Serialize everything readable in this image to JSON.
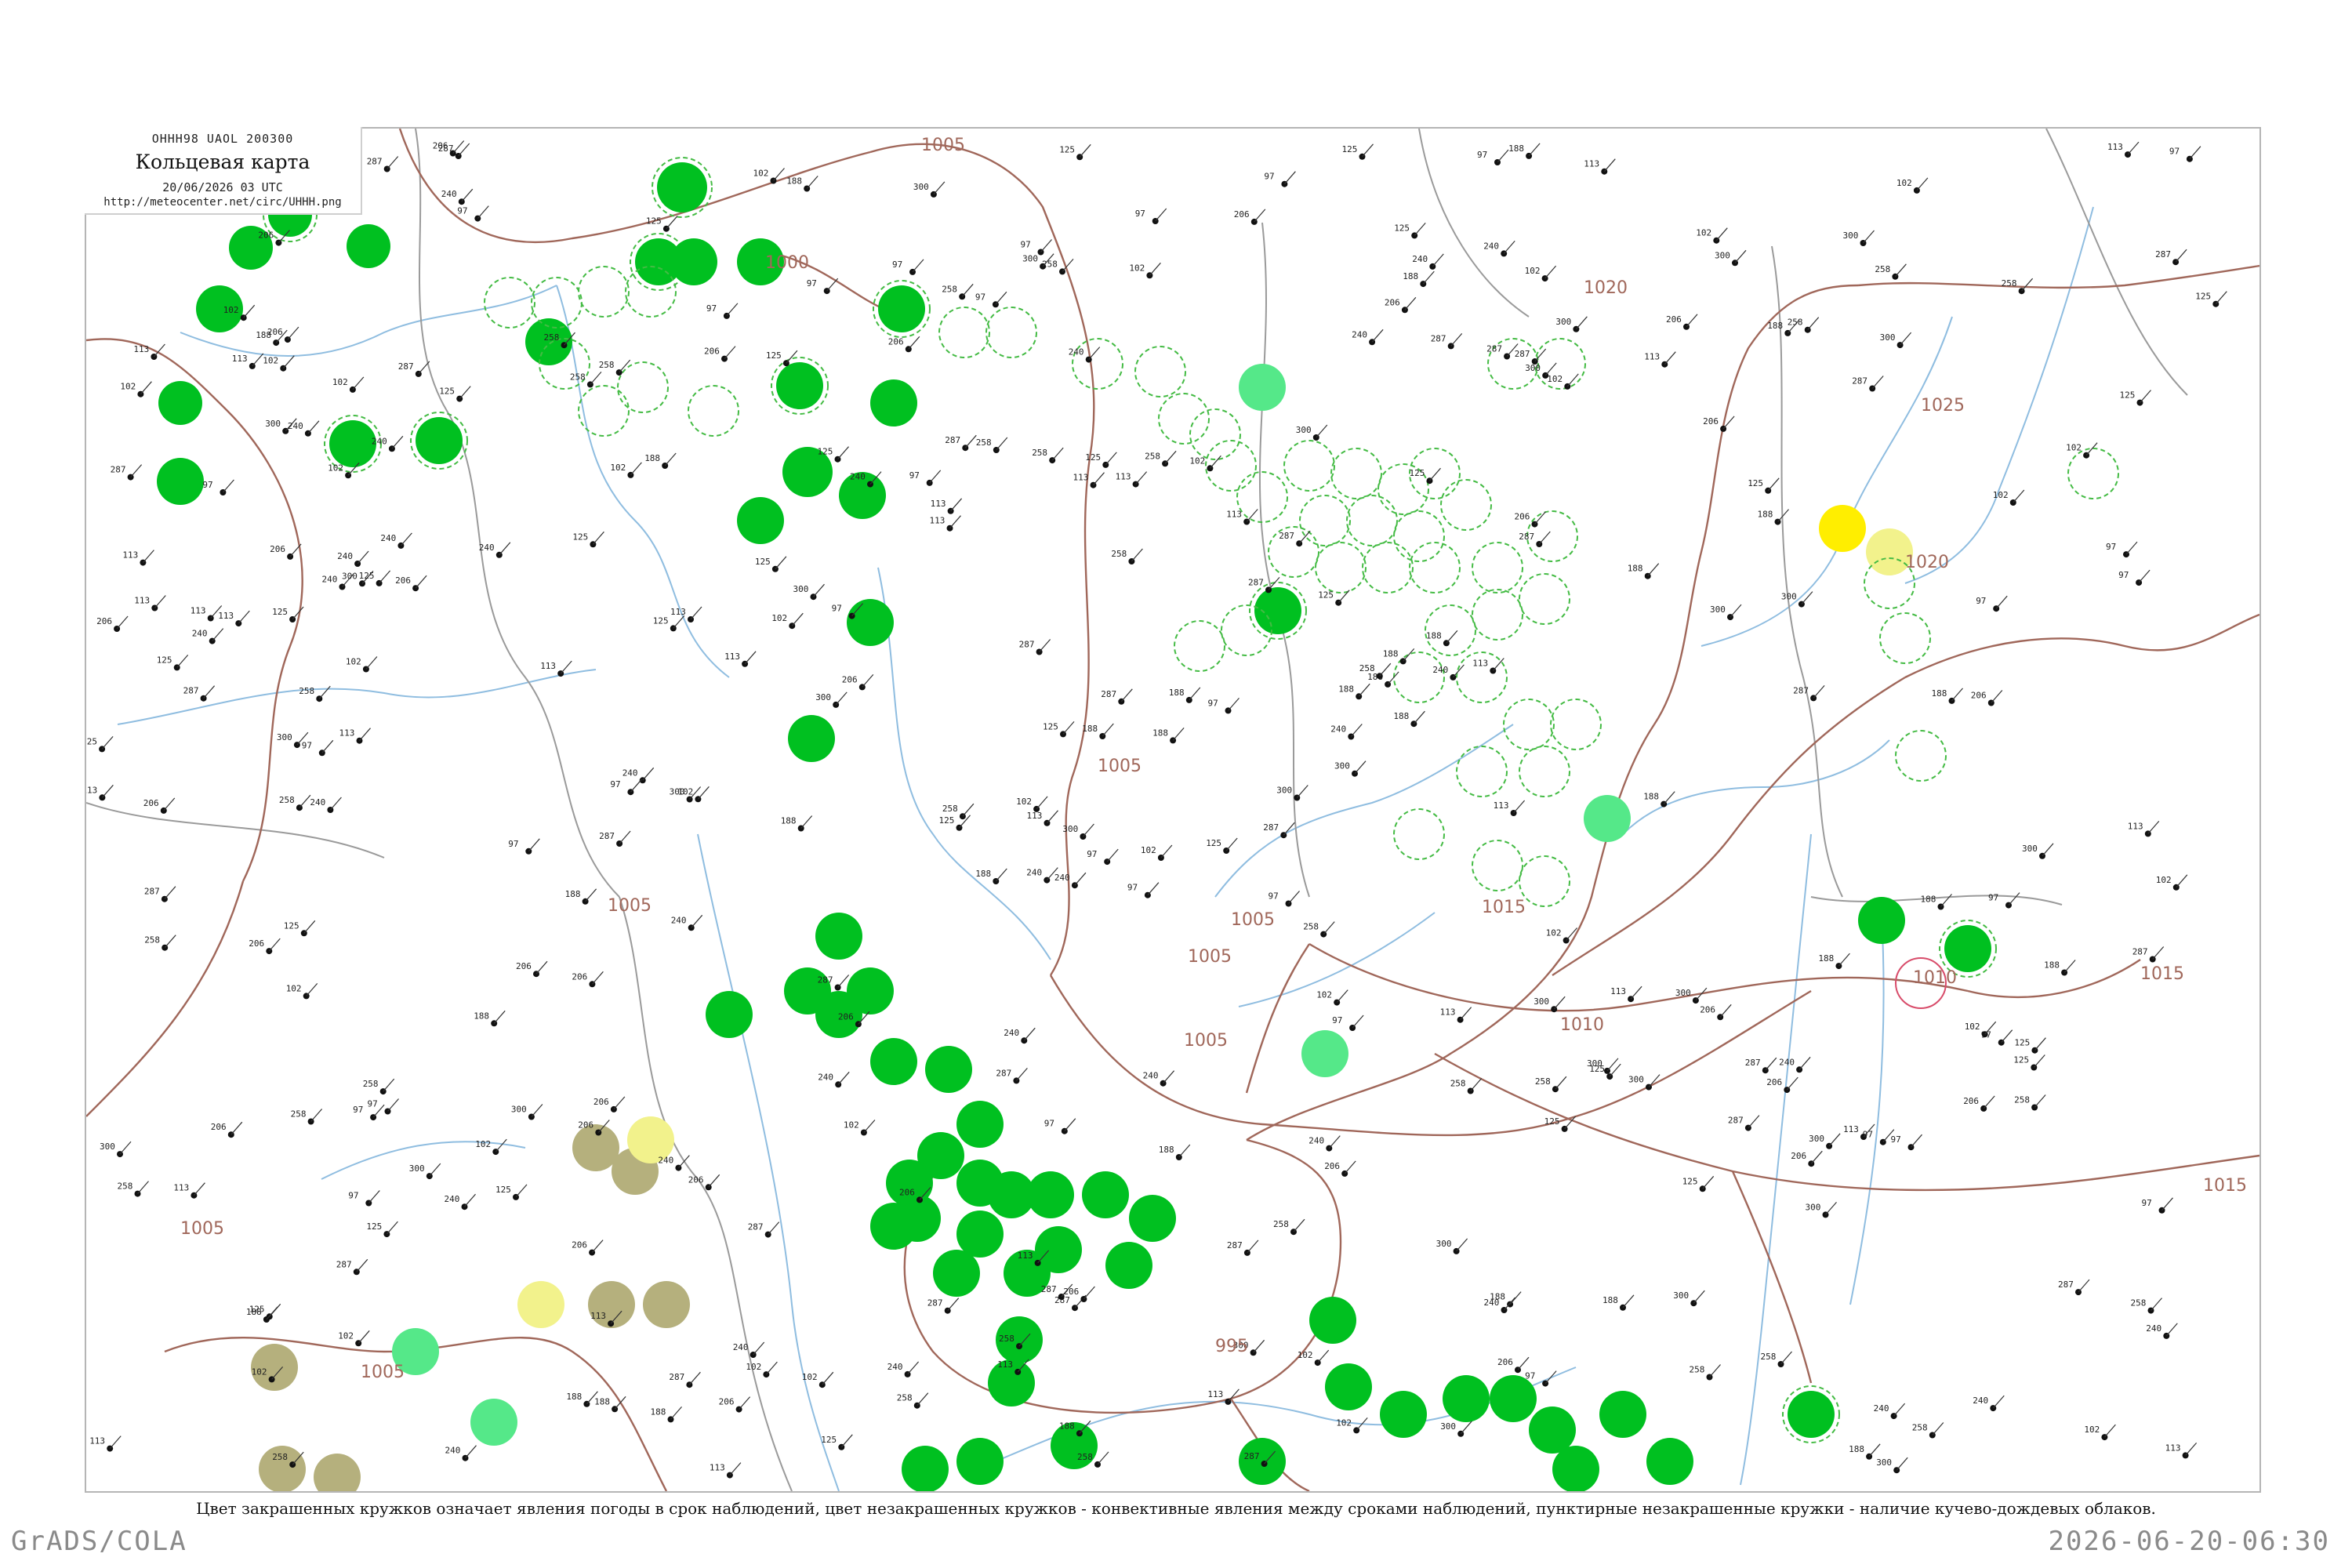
{
  "header": {
    "code": "ОННН98  UAOL  200300",
    "title": "Кольцевая карта",
    "datetime": "20/06/2026 03 UTC",
    "url": "http://meteocenter.net/circ/UHHH.png"
  },
  "legend_note": "Цвет закрашенных кружков означает явления погоды в срок наблюдений, цвет незакрашенных кружков - конвективные явления между сроками наблюдений, пунктирные незакрашенные кружки - наличие кучево-дождевых облаков.",
  "footer": {
    "software": "GrADS/COLA",
    "generated": "2026-06-20-06:30"
  },
  "isobars": {
    "labels": [
      "1005",
      "1000",
      "1005",
      "1005",
      "1005",
      "1005",
      "1010",
      "1015",
      "1020",
      "1025",
      "1020",
      "1010",
      "1005",
      "1015",
      "995",
      "1005",
      "1015",
      "1005"
    ]
  },
  "station_samples": [
    "97",
    "102",
    "113",
    "125",
    "188",
    "206",
    "240",
    "258",
    "287",
    "300"
  ],
  "colors": {
    "isobar": "#a0675a",
    "rivers": "#8fbde0",
    "borders": "#9a9a9a",
    "precip_green": "#00c020",
    "shower_light_green": "#55e889",
    "drizzle_yellow": "#f2f28c",
    "fog_olive": "#b5b07d",
    "strong_yellow": "#ffee00",
    "cb_dashed_ring": "#44bb44",
    "thunder_ring": "#d84c6a"
  }
}
